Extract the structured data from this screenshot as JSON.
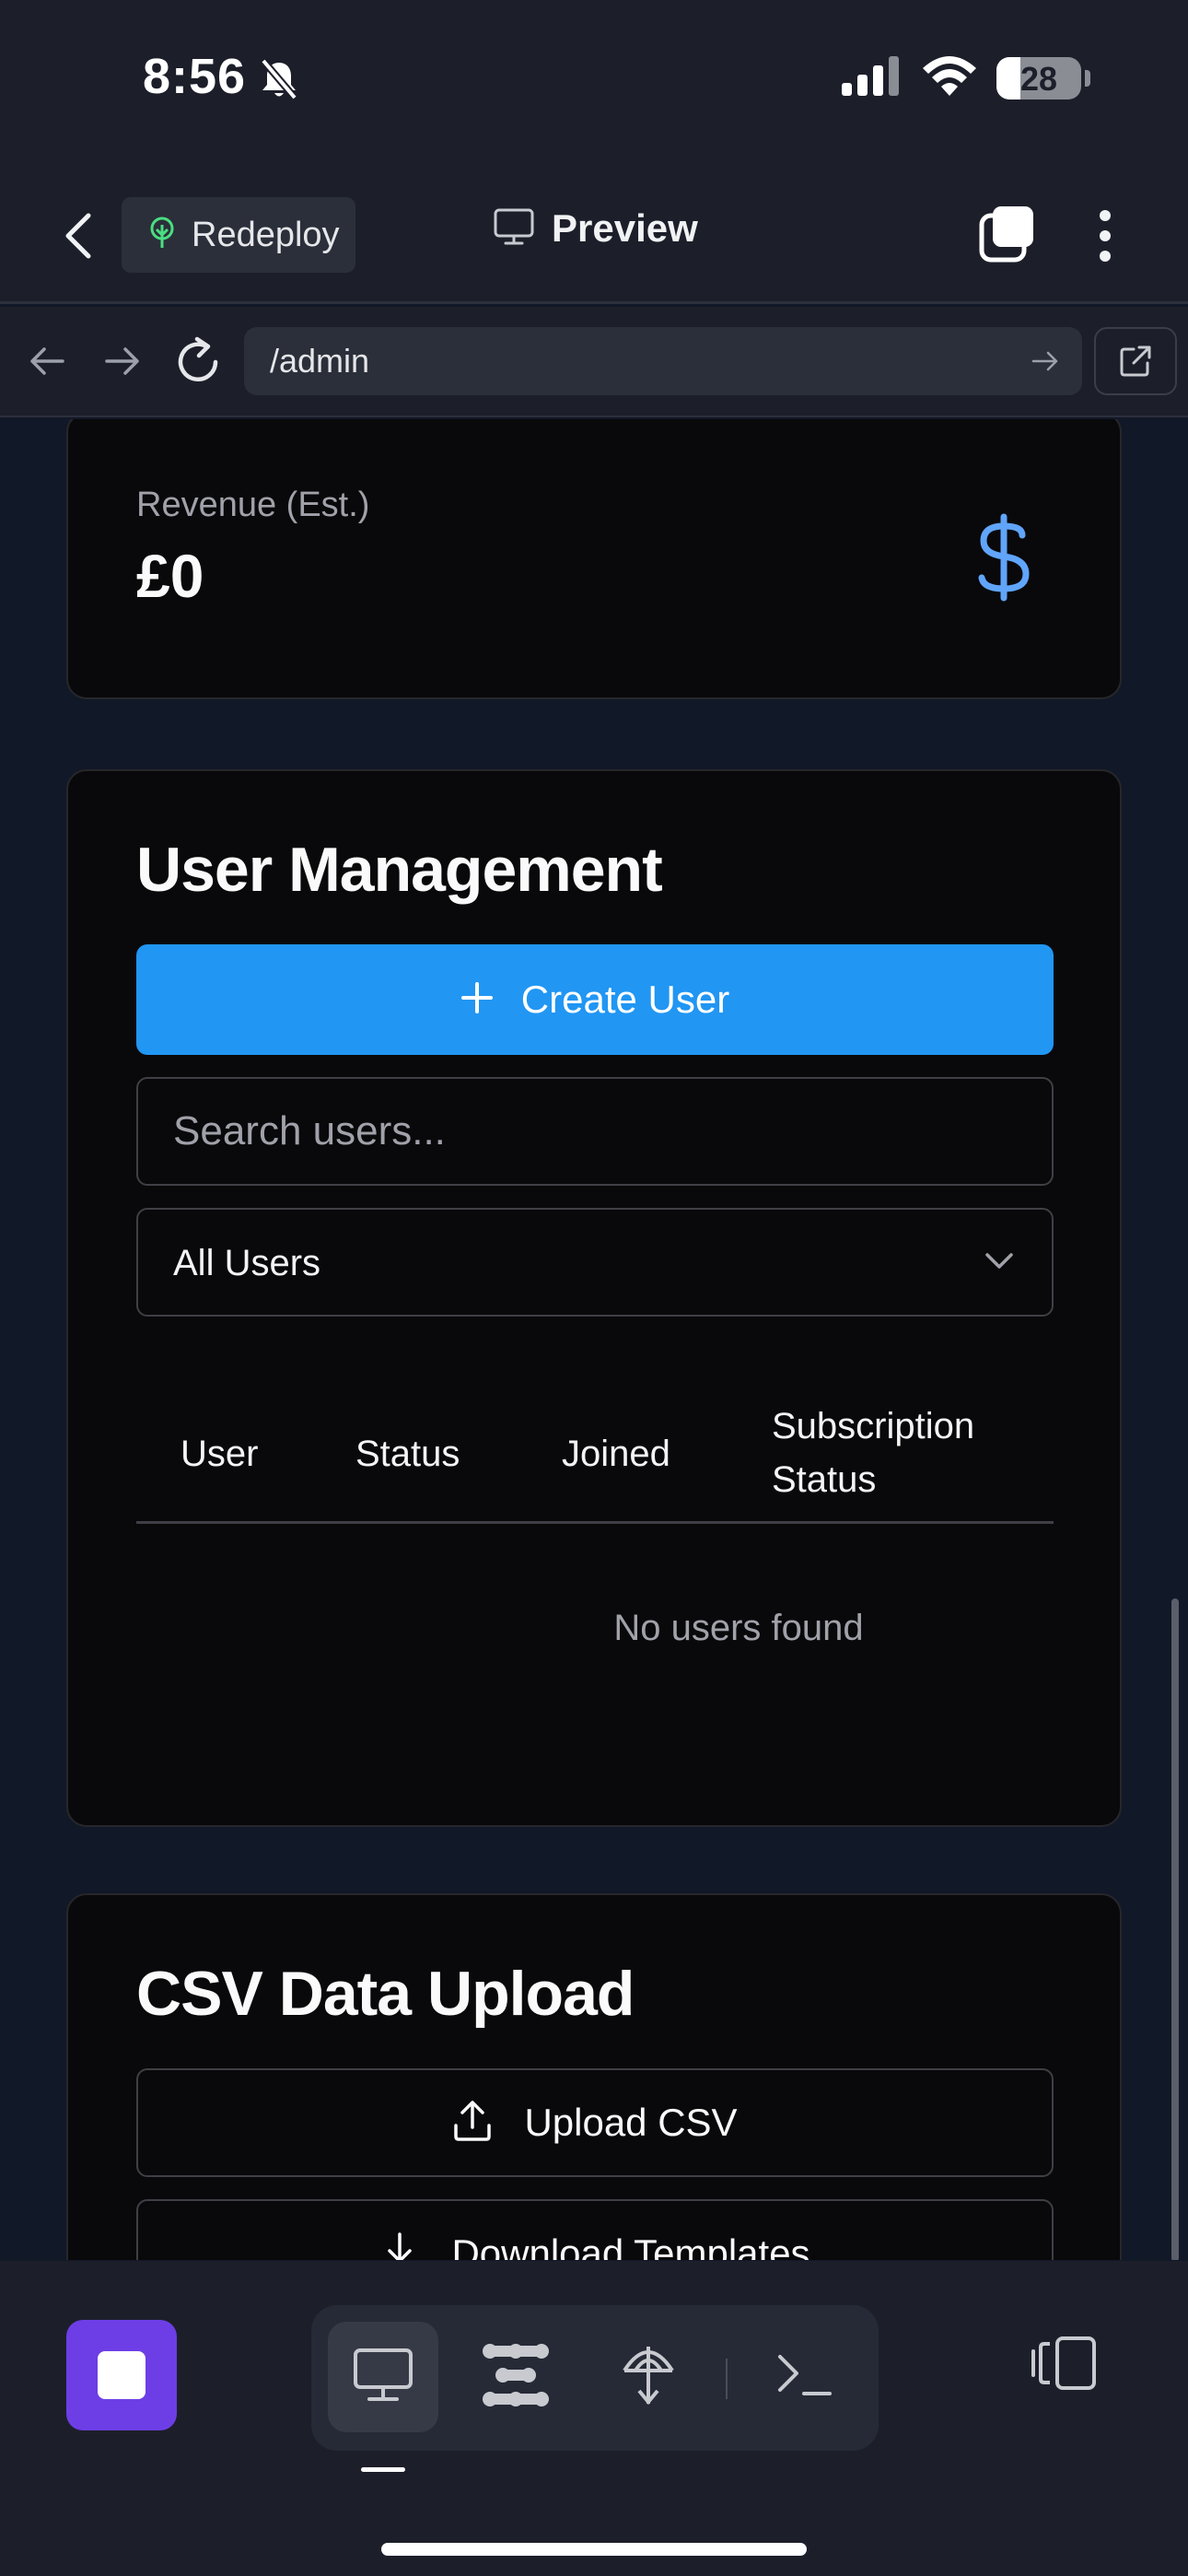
{
  "status_bar": {
    "time": "8:56",
    "battery_level": 28,
    "battery_label": "28",
    "icons": [
      "bell-slash-icon",
      "cellular-signal-icon",
      "wifi-icon",
      "battery-icon"
    ]
  },
  "header": {
    "redeploy_label": "Redeploy",
    "preview_label": "Preview",
    "icons": [
      "chevron-left-icon",
      "deploy-tree-icon",
      "monitor-icon",
      "tabs-icon",
      "more-vertical-icon"
    ]
  },
  "url_bar": {
    "url": "/admin",
    "icons": [
      "arrow-left-icon",
      "arrow-right-icon",
      "reload-icon",
      "arrow-right-small-icon",
      "external-link-icon"
    ]
  },
  "revenue": {
    "label": "Revenue (Est.)",
    "value": "£0",
    "icon": "dollar-icon",
    "icon_color": "#60a5fa"
  },
  "user_management": {
    "title": "User Management",
    "create_label": "Create User",
    "search_placeholder": "Search users...",
    "filter_value": "All Users",
    "columns": [
      "User",
      "Status",
      "Joined",
      "Subscription Status"
    ],
    "empty_text": "No users found",
    "accent": "#2196f3"
  },
  "csv_upload": {
    "title": "CSV Data Upload",
    "upload_label": "Upload CSV",
    "download_label": "Download Templates"
  },
  "bottom_toolbar": {
    "stop_color": "#6d3ee6",
    "tools": [
      "monitor-icon",
      "apps-icon",
      "deploy-icon",
      "terminal-icon"
    ],
    "device_icon": "device-toggle-icon"
  }
}
